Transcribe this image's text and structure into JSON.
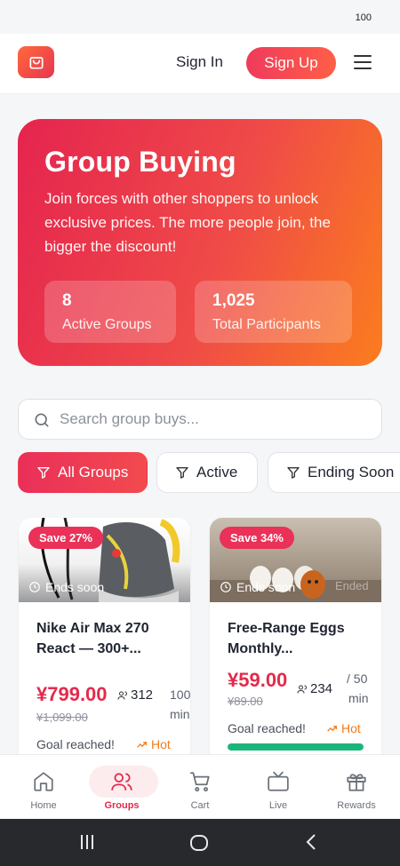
{
  "status_bar": {
    "battery": "100"
  },
  "header": {
    "logo_icon": "shopping-bag-icon",
    "sign_in": "Sign In",
    "sign_up": "Sign Up",
    "menu_icon": "hamburger-menu-icon"
  },
  "hero": {
    "title": "Group Buying",
    "description": "Join forces with other shoppers to unlock exclusive prices. The more people join, the bigger the discount!",
    "stats": [
      {
        "value": "8",
        "label": "Active Groups"
      },
      {
        "value": "1,025",
        "label": "Total Participants"
      }
    ]
  },
  "search": {
    "placeholder": "Search group buys...",
    "value": ""
  },
  "filters": [
    {
      "label": "All Groups",
      "active": true
    },
    {
      "label": "Active",
      "active": false
    },
    {
      "label": "Ending Soon",
      "active": false
    }
  ],
  "products": [
    {
      "badge": "Save 27%",
      "status": "Ends soon",
      "title": "Nike Air Max 270 React — 300+...",
      "price": "¥799.00",
      "old_price": "¥1,099.00",
      "participants": "312",
      "min": "100",
      "min_unit": "min",
      "goal_text": "Goal reached!",
      "tag": "Hot",
      "progress": 1.0
    },
    {
      "badge": "Save 34%",
      "status": "Ends soon",
      "status_extra": "Ended",
      "title": "Free-Range Eggs Monthly...",
      "price": "¥59.00",
      "old_price": "¥89.00",
      "participants": "234",
      "min": "/ 50",
      "min_unit": "min",
      "goal_text": "Goal reached!",
      "tag": "Hot",
      "progress": 1.0
    }
  ],
  "bottom_nav": [
    {
      "label": "Home",
      "icon": "home-icon",
      "active": false
    },
    {
      "label": "Groups",
      "icon": "users-icon",
      "active": true
    },
    {
      "label": "Cart",
      "icon": "cart-icon",
      "active": false
    },
    {
      "label": "Live",
      "icon": "tv-icon",
      "active": false
    },
    {
      "label": "Rewards",
      "icon": "gift-icon",
      "active": false
    }
  ],
  "colors": {
    "accent": "#e42a4c",
    "orange": "#f27b1c",
    "success": "#1bb57a"
  }
}
